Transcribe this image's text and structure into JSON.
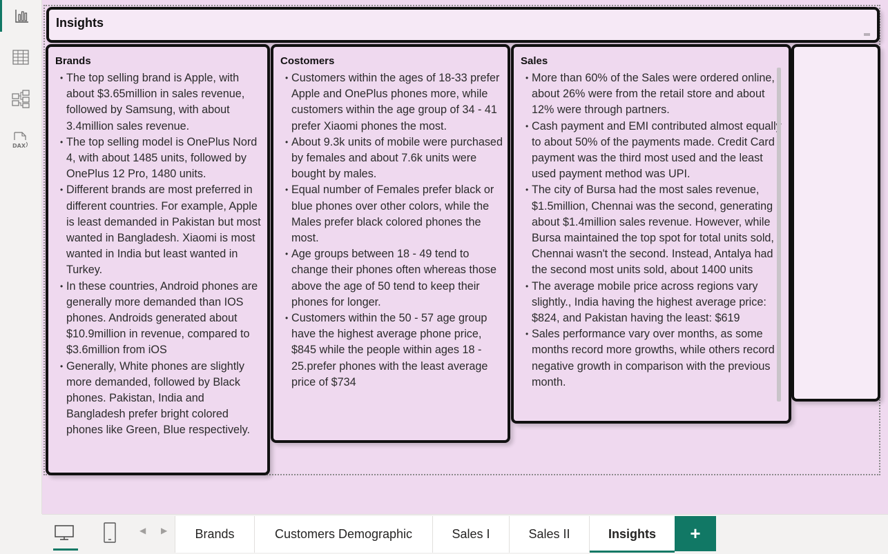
{
  "colors": {
    "accent": "#117865",
    "canvas_bg": "#efd9ef",
    "card_border": "#111111"
  },
  "rail": [
    {
      "icon": "report-view-icon",
      "active": true
    },
    {
      "icon": "table-view-icon",
      "active": false
    },
    {
      "icon": "model-view-icon",
      "active": false
    },
    {
      "icon": "dax-query-view-icon",
      "active": false
    }
  ],
  "header": {
    "title": "Insights"
  },
  "cards": {
    "brands": {
      "title": "Brands",
      "items": [
        "The  top selling brand is Apple, with about $3.65million in sales revenue, followed by Samsung, with about 3.4million sales revenue.",
        "The top selling model is OnePlus Nord 4, with about  1485 units, followed by OnePlus 12 Pro, 1480 units.",
        "Different brands are most preferred in different countries. For example, Apple is least demanded in Pakistan but most wanted in Bangladesh. Xiaomi is most wanted in India but least wanted in Turkey.",
        " In these countries, Android phones are generally more demanded than IOS phones. Androids generated about $10.9million in revenue, compared to $3.6million from iOS",
        "Generally, White phones are slightly more demanded, followed by Black phones. Pakistan, India and Bangladesh prefer bright colored phones like Green, Blue respectively."
      ]
    },
    "customers": {
      "title": "Costomers",
      "items": [
        "Customers within the ages of 18-33 prefer Apple and OnePlus phones more, while customers within the age group of 34 - 41 prefer Xiaomi phones the most.",
        "About 9.3k units of mobile were purchased by females and about 7.6k units were bought by males.",
        "Equal number of Females prefer black  or blue phones over other colors, while the Males prefer black colored phones the most.",
        "Age groups between 18 - 49 tend to change their phones often whereas those above the age of 50 tend to keep their phones for longer.",
        "Customers within the 50 - 57 age group have the highest average phone price, $845 while the people within ages 18 - 25.prefer phones with the least average price of $734"
      ]
    },
    "sales": {
      "title": "Sales",
      "items": [
        "More than 60% of the Sales were ordered online, about 26% were from the retail store and about 12% were through partners.",
        "Cash payment and EMI contributed almost equally to about 50% of the payments made. Credit Card payment was the third most used and the least used payment method was UPI.",
        "The city of Bursa had the most sales revenue, $1.5million, Chennai was the second, generating about $1.4million sales revenue. However, while Bursa maintained the top spot for total units sold, Chennai wasn't the second. Instead, Antalya had the second most units sold, about 1400 units",
        "The average mobile price across regions vary slightly., India having the highest average price: $824, and Pakistan having the least: $619",
        "Sales performance vary over months, as some months record more growths, while others record negative growth in comparison with the previous month."
      ]
    }
  },
  "tabbar": {
    "view_buttons": [
      "desktop-view-icon",
      "mobile-view-icon"
    ],
    "tabs": [
      {
        "label": "Brands",
        "active": false
      },
      {
        "label": "Customers Demographic",
        "active": false
      },
      {
        "label": "Sales I",
        "active": false
      },
      {
        "label": "Sales II",
        "active": false
      },
      {
        "label": "Insights",
        "active": true
      }
    ],
    "add_label": "+"
  }
}
